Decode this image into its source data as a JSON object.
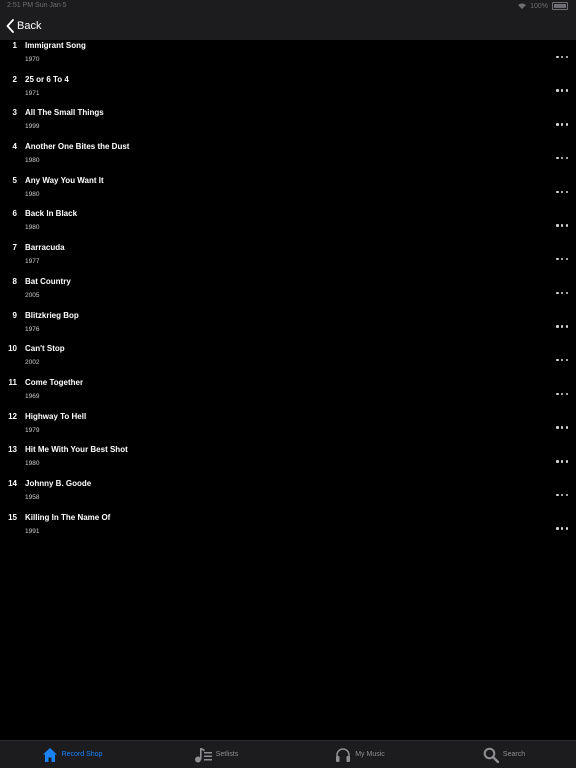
{
  "status": {
    "time": "2:51 PM",
    "date": "Sun Jan 5",
    "battery": "100%"
  },
  "nav": {
    "back_label": "Back"
  },
  "songs": [
    {
      "num": "1",
      "title": "Immigrant Song",
      "year": "1970"
    },
    {
      "num": "2",
      "title": "25 or 6 To 4",
      "year": "1971"
    },
    {
      "num": "3",
      "title": "All The Small Things",
      "year": "1999"
    },
    {
      "num": "4",
      "title": "Another One Bites the Dust",
      "year": "1980"
    },
    {
      "num": "5",
      "title": "Any Way You Want It",
      "year": "1980"
    },
    {
      "num": "6",
      "title": "Back In Black",
      "year": "1980"
    },
    {
      "num": "7",
      "title": "Barracuda",
      "year": "1977"
    },
    {
      "num": "8",
      "title": "Bat Country",
      "year": "2005"
    },
    {
      "num": "9",
      "title": "Blitzkrieg Bop",
      "year": "1976"
    },
    {
      "num": "10",
      "title": "Can't Stop",
      "year": "2002"
    },
    {
      "num": "11",
      "title": "Come Together",
      "year": "1969"
    },
    {
      "num": "12",
      "title": "Highway To Hell",
      "year": "1979"
    },
    {
      "num": "13",
      "title": "Hit Me With Your Best Shot",
      "year": "1980"
    },
    {
      "num": "14",
      "title": "Johnny B. Goode",
      "year": "1958"
    },
    {
      "num": "15",
      "title": "Killing In The Name Of",
      "year": "1991"
    }
  ],
  "tabs": [
    {
      "label": "Record Shop",
      "icon": "house-icon",
      "active": true
    },
    {
      "label": "Setlists",
      "icon": "music-note-list-icon",
      "active": false
    },
    {
      "label": "My Music",
      "icon": "headphones-icon",
      "active": false
    },
    {
      "label": "Search",
      "icon": "search-icon",
      "active": false
    }
  ],
  "colors": {
    "background": "#000000",
    "bar": "#1c1c1e",
    "accent": "#1a82fb",
    "inactive": "#8e8e93"
  }
}
